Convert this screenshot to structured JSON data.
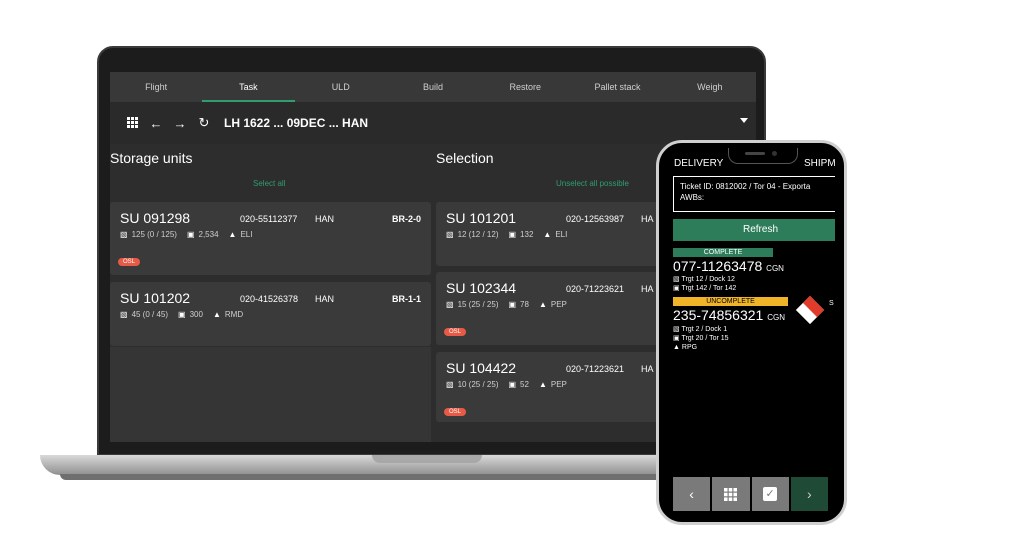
{
  "laptop": {
    "tabs": [
      "Flight",
      "Task",
      "ULD",
      "Build",
      "Restore",
      "Pallet stack",
      "Weigh"
    ],
    "active_tab": 1,
    "toolbar": {
      "apps_icon": "grid-icon",
      "back_icon": "arrow-left-icon",
      "forward_icon": "arrow-right-icon",
      "refresh_icon": "refresh-icon",
      "flight": "LH 1622 ... 09DEC ... HAN"
    },
    "storage": {
      "title": "Storage units",
      "select_all": "Select all",
      "cards": [
        {
          "su": "SU 091298",
          "awb": "020-55112377",
          "dest": "HAN",
          "loc": "BR-2-0",
          "pieces": "125 (0 / 125)",
          "weight": "2,534",
          "shc": "ELI",
          "badge": "OSL"
        },
        {
          "su": "SU 101202",
          "awb": "020-41526378",
          "dest": "HAN",
          "loc": "BR-1-1",
          "pieces": "45 (0 / 45)",
          "weight": "300",
          "shc": "RMD",
          "badge": ""
        }
      ]
    },
    "selection": {
      "title": "Selection",
      "unselect_all": "Unselect all possible",
      "cards": [
        {
          "su": "SU 101201",
          "awb": "020-12563987",
          "dest": "HA",
          "pieces": "12 (12 / 12)",
          "weight": "132",
          "shc": "ELI",
          "badge": ""
        },
        {
          "su": "SU 102344",
          "awb": "020-71223621",
          "dest": "HA",
          "pieces": "15 (25 / 25)",
          "weight": "78",
          "shc": "PEP",
          "badge": "OSL"
        },
        {
          "su": "SU 104422",
          "awb": "020-71223621",
          "dest": "HA",
          "pieces": "10 (25 / 25)",
          "weight": "52",
          "shc": "PEP",
          "badge": "OSL"
        }
      ]
    }
  },
  "phone": {
    "tab_left": "DELIVERY",
    "tab_right": "SHIPM",
    "ticket_line1": "Ticket ID:  0812002 / Tor 04 - Exporta",
    "ticket_line2": "AWBs:",
    "refresh": "Refresh",
    "items": [
      {
        "status": "COMPLETE",
        "awb": "077-11263478",
        "origin": "CGN",
        "line1": "Trgt 12 / Dock 12",
        "line2": "Trgt 142 / Tor 142",
        "line3": ""
      },
      {
        "status": "UNCOMPLETE",
        "awb": "235-74856321",
        "origin": "CGN",
        "line1": "Trgt 2 / Dock 1",
        "line2": "Trgt 20 / Tor 15",
        "line3": "RPG"
      }
    ],
    "edge_letter": "S",
    "nav": [
      "chevron-left-icon",
      "grid-icon",
      "check-icon",
      "chevron-right-icon"
    ]
  }
}
